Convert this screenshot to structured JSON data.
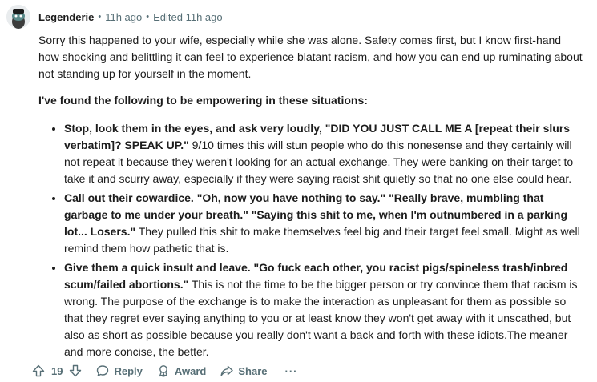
{
  "comment": {
    "username": "Legenderie",
    "time": "11h ago",
    "edited": "Edited 11h ago",
    "separator": "•",
    "paragraph1": "Sorry this happened to your wife, especially while she was alone. Safety comes first, but I know first-hand how shocking and belittling it can feel to experience blatant racism, and how you can end up ruminating about not standing up for yourself in the moment.",
    "paragraph2": "I've found the following to be empowering in these situations:",
    "bullets": [
      {
        "bold": "Stop, look them in the eyes, and ask very loudly, \"DID YOU JUST CALL ME A [repeat their slurs verbatim]? SPEAK UP.\"",
        "text": " 9/10 times this will stun people who do this nonesense and they certainly will not repeat it because they weren't looking for an actual exchange. They were banking on their target to take it and scurry away, especially if they were saying racist shit quietly so that no one else could hear."
      },
      {
        "bold": "Call out their cowardice. \"Oh, now you have nothing to say.\" \"Really brave, mumbling that garbage to me under your breath.\" \"Saying this shit to me, when I'm outnumbered in a parking lot... Losers.\"",
        "text": " They pulled this shit to make themselves feel big and their target feel small. Might as well remind them how pathetic that is."
      },
      {
        "bold": "Give them a quick insult and leave. \"Go fuck each other, you racist pigs/spineless trash/inbred scum/failed abortions.\"",
        "text": " This is not the time to be the bigger person or try convince them that racism is wrong. The purpose of the exchange is to make the interaction as unpleasant for them as possible so that they regret ever saying anything to you or at least know they won't get away with it unscathed, but also as short as possible because you really don't want a back and forth with these idiots.The meaner and more concise, the better."
      }
    ]
  },
  "actions": {
    "score": "19",
    "reply": "Reply",
    "award": "Award",
    "share": "Share",
    "more": "···"
  },
  "icons": {
    "avatar": "snoo-avatar",
    "upvote": "arrow-up-icon",
    "downvote": "arrow-down-icon",
    "reply": "speech-bubble-icon",
    "award": "award-icon",
    "share": "share-arrow-icon"
  },
  "colors": {
    "text": "#1c1c1c",
    "meta": "#576f76"
  }
}
